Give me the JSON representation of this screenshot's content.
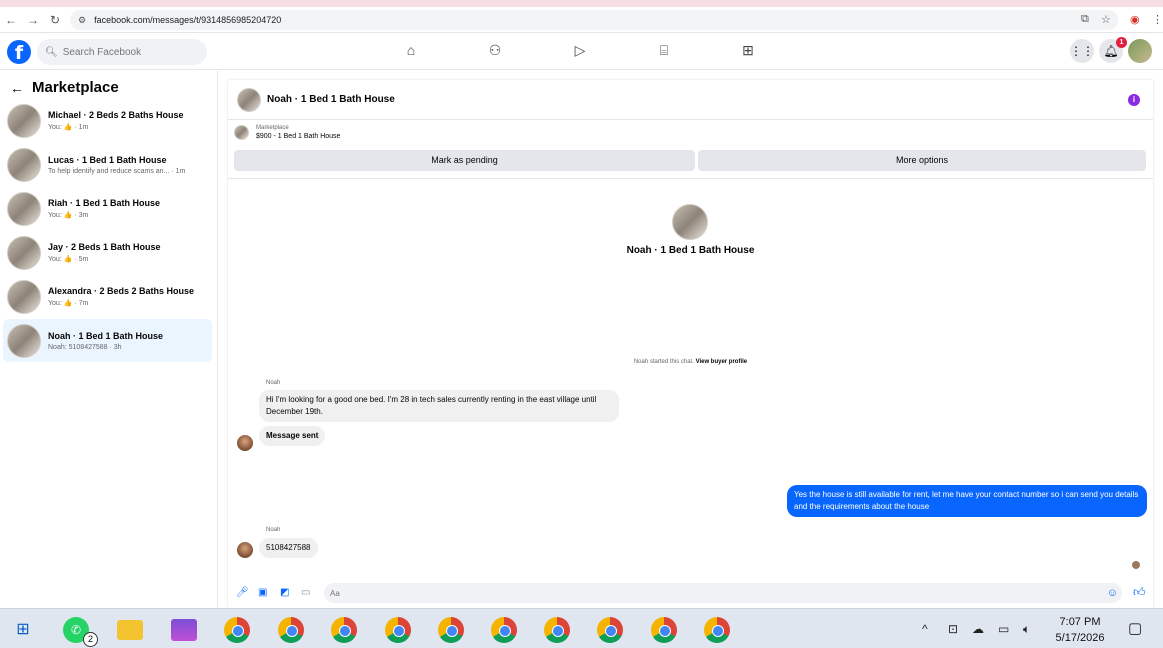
{
  "browser": {
    "url": "facebook.com/messages/t/9314856985204720"
  },
  "header": {
    "logo_letter": "f",
    "search_placeholder": "Search Facebook",
    "notification_count": "1",
    "icons": [
      "home-icon",
      "friends-icon",
      "video-icon",
      "marketplace-icon",
      "gaming-icon",
      "menu-grid-icon",
      "bell-icon",
      "profile-avatar"
    ]
  },
  "sidebar": {
    "title": "Marketplace",
    "conversations": [
      {
        "title": "Michael · 2 Beds 2 Baths House",
        "preview": "You: 👍 · 1m"
      },
      {
        "title": "Lucas · 1 Bed 1 Bath House",
        "preview": "To help identify and reduce scams an... · 1m"
      },
      {
        "title": "Riah · 1 Bed 1 Bath House",
        "preview": "You: 👍 · 3m"
      },
      {
        "title": "Jay · 2 Beds 1 Bath House",
        "preview": "You: 👍 · 5m"
      },
      {
        "title": "Alexandra · 2 Beds 2 Baths House",
        "preview": "You: 👍 · 7m"
      },
      {
        "title": "Noah · 1 Bed 1 Bath House",
        "preview": "Noah: 5108427588 · 3h",
        "selected": true
      }
    ]
  },
  "chat": {
    "title": "Noah · 1 Bed 1 Bath House",
    "marketplace_label": "Marketplace",
    "listing": "$900 - 1 Bed 1 Bath House",
    "mark_pending": "Mark as pending",
    "more_options": "More options",
    "center_name": "Noah · 1 Bed 1 Bath House",
    "started_text": "Noah started this chat.",
    "view_profile": "View buyer profile",
    "messages": [
      {
        "sender": "Noah",
        "text": "Hi I'm looking for a good one bed. I'm 28 in tech sales currently renting in the east village until December 19th."
      },
      {
        "sender": "",
        "text": "Message sent"
      },
      {
        "sender": "me",
        "text": "Yes the house is still available for rent, let me have your contact number so i can send you details and the requirements about the house"
      },
      {
        "sender": "Noah",
        "text": "5108427588"
      }
    ],
    "composer_placeholder": "Aa"
  },
  "taskbar": {
    "time": "7:07 PM",
    "date": "5/17/2026",
    "whatsapp_badge": "2"
  }
}
